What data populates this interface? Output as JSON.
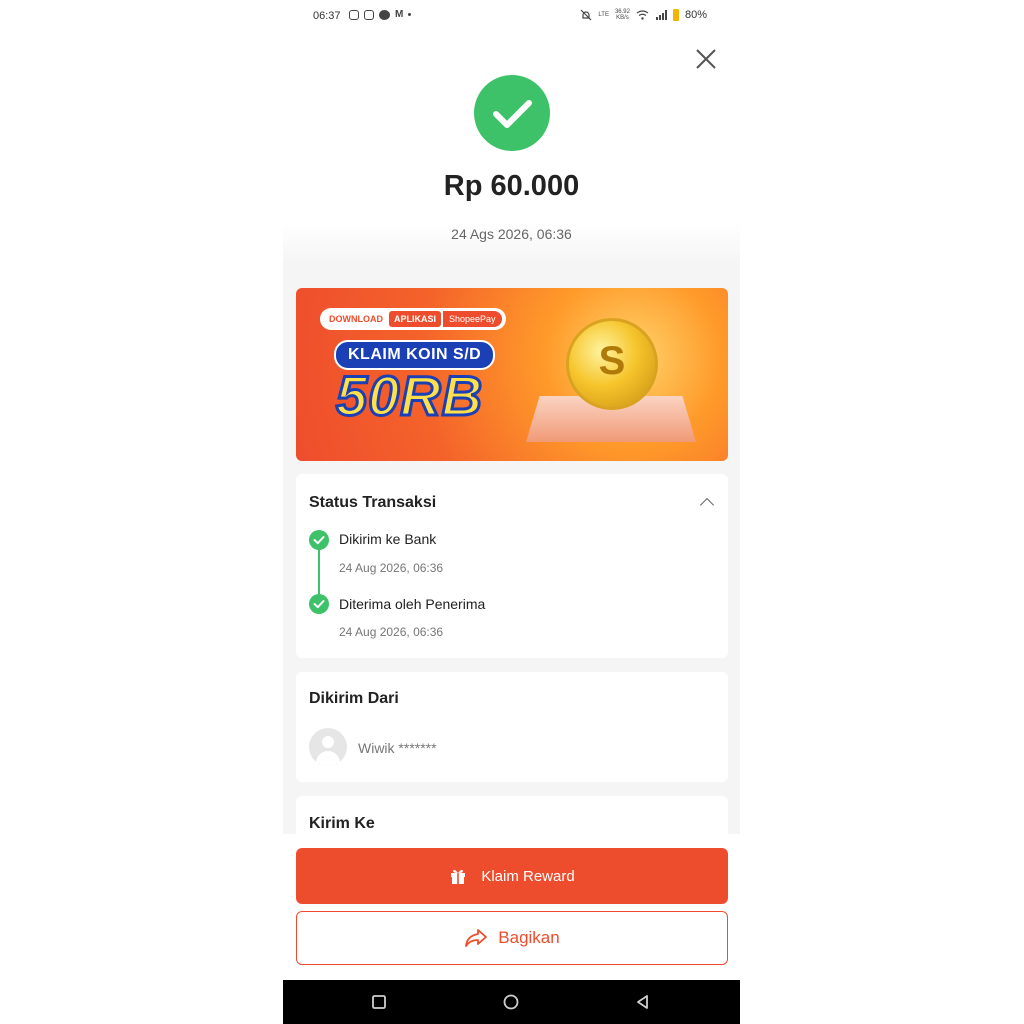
{
  "status_bar": {
    "time": "06:37",
    "network_label": "LTE",
    "speed_value": "36.92",
    "speed_unit": "KB/s",
    "battery": "80%"
  },
  "receipt": {
    "amount": "Rp 60.000",
    "date": "24 Ags 2026, 06:36"
  },
  "banner": {
    "download": "DOWNLOAD",
    "aplikasi": "APLIKASI",
    "shopeepay": "ShopeePay",
    "headline": "KLAIM KOIN S/D",
    "amount": "50RB",
    "coin_letter": "S"
  },
  "status_card": {
    "title": "Status Transaksi",
    "steps": [
      {
        "label": "Dikirim ke Bank",
        "date": "24 Aug 2026, 06:36"
      },
      {
        "label": "Diterima oleh Penerima",
        "date": "24 Aug 2026, 06:36"
      }
    ]
  },
  "sender_card": {
    "title": "Dikirim Dari",
    "name": "Wiwik *******"
  },
  "recipient_card": {
    "title": "Kirim Ke"
  },
  "actions": {
    "claim_label": "Klaim Reward",
    "share_label": "Bagikan"
  },
  "colors": {
    "brand": "#ee4d2d",
    "success": "#3dc26a"
  },
  "icons": [
    "close-icon",
    "check-icon",
    "chevron-up-icon",
    "gift-icon",
    "share-icon",
    "avatar-icon",
    "recents-icon",
    "home-icon",
    "back-icon"
  ]
}
